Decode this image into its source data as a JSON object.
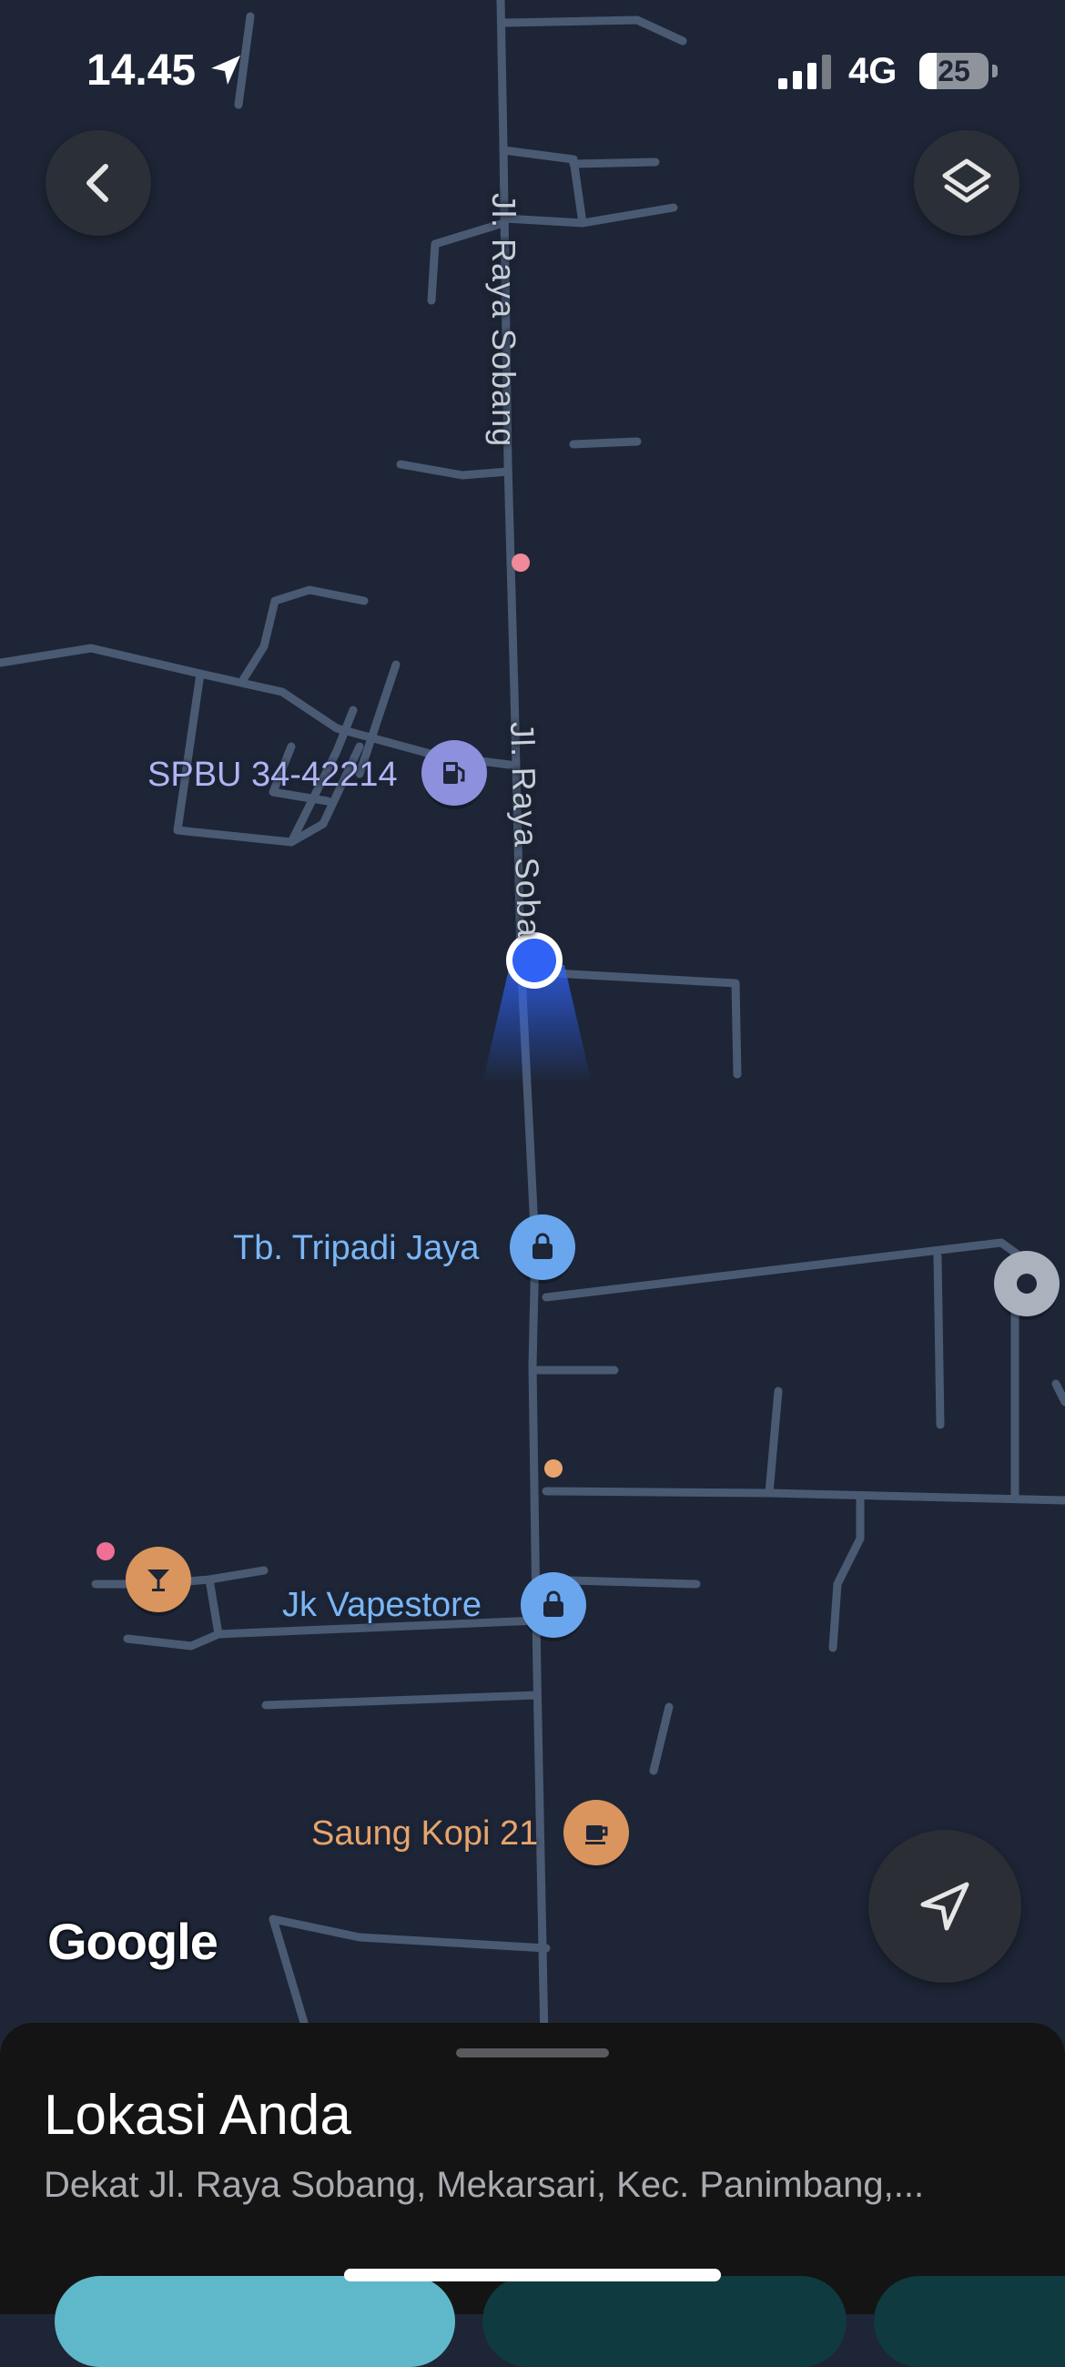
{
  "status_bar": {
    "time": "14.45",
    "network": "4G",
    "battery": "25",
    "battery_level_percent": 25
  },
  "map": {
    "road_labels": [
      "Jl. Raya Sobang",
      "Jl. Raya Soba"
    ],
    "pois": [
      {
        "name": "SPBU 34-42214",
        "icon": "gas-station-icon",
        "color": "#b1b4f2"
      },
      {
        "name": "Tb. Tripadi Jaya",
        "icon": "shopping-bag-icon",
        "color": "#7bb6f5"
      },
      {
        "name": "Jk Vapestore",
        "icon": "shopping-bag-icon",
        "color": "#7bb6f5"
      },
      {
        "name": "Saung Kopi 21",
        "icon": "coffee-cup-icon",
        "color": "#e8a46c"
      }
    ],
    "unlabeled_pins": [
      "cocktail-icon",
      "place-icon"
    ],
    "attribution": "Google",
    "colors": {
      "background": "#1d2536",
      "road": "#4a5a73",
      "location_dot": "#2f62f5"
    }
  },
  "controls": {
    "back": "back-arrow-icon",
    "layers": "layers-icon",
    "recenter": "navigation-arrow-icon"
  },
  "sheet": {
    "title": "Lokasi Anda",
    "subtitle": "Dekat Jl. Raya Sobang, Mekarsari, Kec. Panimbang,..."
  }
}
